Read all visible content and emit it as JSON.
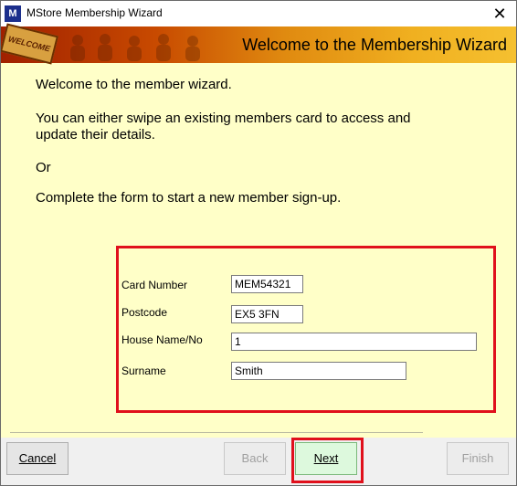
{
  "window": {
    "title": "MStore Membership Wizard",
    "app_icon": "M",
    "close_symbol": "✕"
  },
  "banner": {
    "sign_text": "WELCOME",
    "title": "Welcome to the Membership Wizard"
  },
  "intro": {
    "line1": "Welcome to the member wizard.",
    "line2a": "You can either swipe an existing members card to access and",
    "line2b": "update their details.",
    "line3": "Or",
    "line4": "Complete the form to start a new member sign-up."
  },
  "form": {
    "card_number_label": "Card Number",
    "card_number_value": "MEM54321",
    "postcode_label": "Postcode",
    "postcode_value": "EX5 3FN",
    "house_label": "House Name/No",
    "house_value": "1",
    "surname_label": "Surname",
    "surname_value": "Smith"
  },
  "buttons": {
    "cancel": "Cancel",
    "back": "Back",
    "next": "Next",
    "finish": "Finish"
  },
  "colors": {
    "background": "#ffffc8",
    "highlight": "#e0101c",
    "next_button": "#ddf9dd"
  }
}
